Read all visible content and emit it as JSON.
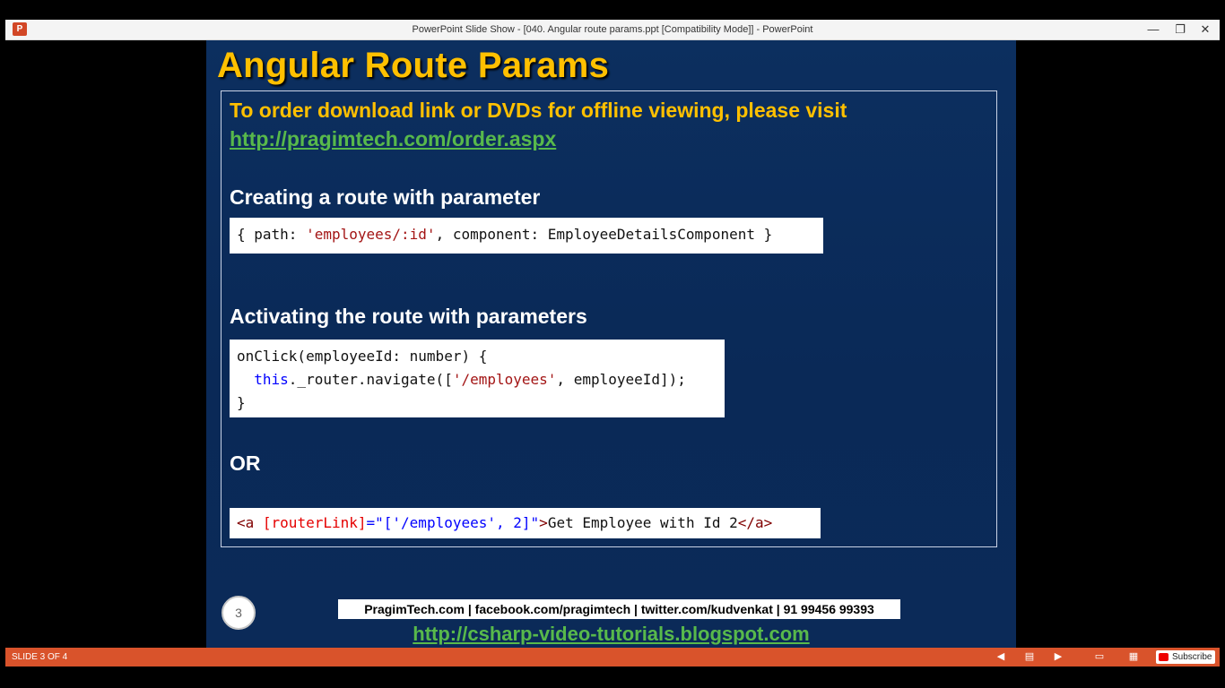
{
  "window": {
    "title": "PowerPoint Slide Show - [040. Angular route params.ppt [Compatibility Mode]] - PowerPoint",
    "app_icon_label": "P",
    "minimize_glyph": "—",
    "restore_glyph": "❐",
    "close_glyph": "✕"
  },
  "slide": {
    "title": "Angular Route Params",
    "order_text": "To order download link or DVDs for offline viewing, please visit",
    "order_link": "http://pragimtech.com/order.aspx",
    "heading_create": "Creating a route with parameter",
    "code_route": {
      "pre": "{ path: ",
      "str": "'employees/:id'",
      "post": ", component: EmployeeDetailsComponent }"
    },
    "heading_activate": "Activating the route with parameters",
    "code_onclick": {
      "line1": "onClick(employeeId: number) {",
      "line2_indent": "  ",
      "line2_kw": "this",
      "line2_mid": "._router.navigate([",
      "line2_str": "'/employees'",
      "line2_end": ", employeeId]);",
      "line3": "}"
    },
    "or_label": "OR",
    "code_link": {
      "tag_open": "<a ",
      "attr": "[routerLink]",
      "eq": "=",
      "value": "\"['/employees', 2]\"",
      "gt": ">",
      "text": "Get Employee with Id 2",
      "tag_close": "</a>"
    },
    "slide_number": "3",
    "footer_contact": "PragimTech.com | facebook.com/pragimtech | twitter.com/kudvenkat | 91 99456 99393",
    "footer_link": "http://csharp-video-tutorials.blogspot.com"
  },
  "statusbar": {
    "slide_counter": "SLIDE 3 OF 4",
    "subscribe_label": "Subscribe"
  }
}
